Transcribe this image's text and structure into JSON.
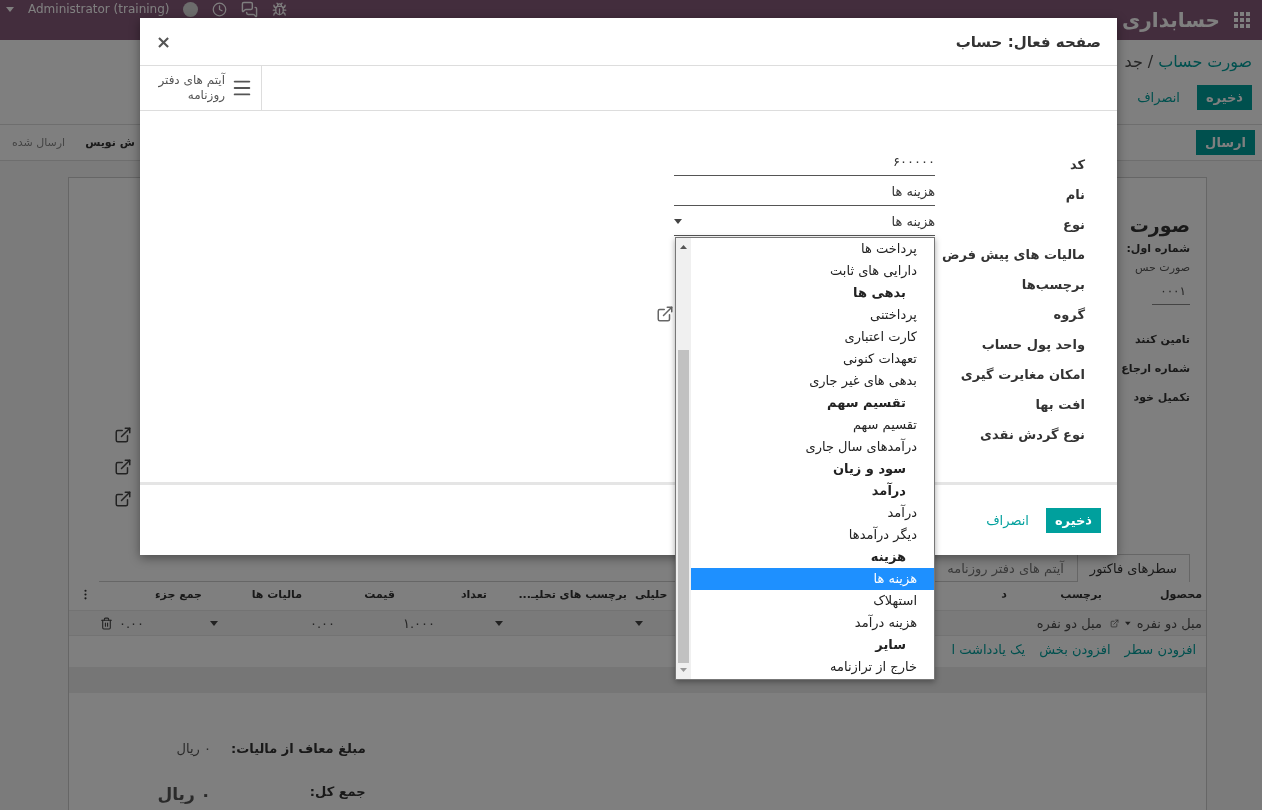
{
  "topbar": {
    "app_title": "حسابداری",
    "user": "Administrator (training)"
  },
  "breadcrumb": {
    "parent": "صورت حساب",
    "separator": "/",
    "current": "جد"
  },
  "form_buttons": [
    {
      "label": "ذخیره",
      "kind": "primary"
    },
    {
      "label": "انصراف",
      "kind": "link"
    }
  ],
  "status_bar": {
    "action": "ارسال",
    "stages": [
      {
        "label": "ش نویس",
        "selected": true
      },
      {
        "label": "ارسال شده",
        "selected": false
      }
    ]
  },
  "sheet": {
    "title": "صورت",
    "number_label": "شماره اول:",
    "journal": "صورت حس",
    "number": "۰۰۰۱",
    "field_labels": [
      "تامین کنند",
      "شماره ارجاع",
      "تکمیل خود"
    ],
    "tabs": [
      {
        "label": "سطرهای فاکتور",
        "selected": true
      },
      {
        "label": "آیتم های دفتر روزنامه",
        "selected": false
      }
    ],
    "table": {
      "columns": [
        "محصول",
        "برچسب",
        "د",
        "حلیلی",
        "برچسب های تحلیـ...",
        "تعداد",
        "قیمت",
        "مالیات ها",
        "جمع جزء"
      ],
      "rows": [
        {
          "product": "مبل دو نفره",
          "label": "مبل دو نفره",
          "quantity": "۱.۰۰۰",
          "price": "۰.۰۰",
          "subtotal": "۰.۰۰"
        }
      ],
      "add_links": [
        "افزودن سطر",
        "افزودن بخش",
        "یک یادداشت ا"
      ]
    },
    "totals": [
      {
        "label": "مبلغ معاف از مالیات:",
        "value": "۰ ریال",
        "kind": "normal"
      },
      {
        "label": "جمع کل:",
        "value": "۰ ریال",
        "kind": "grand"
      }
    ]
  },
  "modal": {
    "title": "صفحه فعال: حساب",
    "close": "×",
    "smart_button": "آیتم های دفتر روزنامه",
    "fields": [
      {
        "label": "کد",
        "kind": "input",
        "value": "۶۰۰۰۰۰"
      },
      {
        "label": "نام",
        "kind": "input",
        "value": "هزینه ها"
      },
      {
        "label": "نوع",
        "kind": "select",
        "value": "هزینه ها"
      },
      {
        "label": "مالیات های پیش فرض"
      },
      {
        "label": "برچسب‌ها"
      },
      {
        "label": "گروه",
        "kind": "link"
      },
      {
        "label": "واحد پول حساب"
      },
      {
        "label": "امکان مغایرت گیری"
      },
      {
        "label": "افت بها"
      },
      {
        "label": "نوع گردش نقدی"
      }
    ],
    "footer_buttons": [
      {
        "label": "ذخیره",
        "kind": "primary"
      },
      {
        "label": "انصراف",
        "kind": "link"
      }
    ],
    "type_options": [
      {
        "label": "پرداخت ها",
        "kind": "option",
        "selected": false
      },
      {
        "label": "دارایی های ثابت",
        "kind": "option",
        "selected": false
      },
      {
        "label": "بدهی ها",
        "kind": "group",
        "selected": false
      },
      {
        "label": "پرداختنی",
        "kind": "option",
        "selected": false
      },
      {
        "label": "کارت اعتباری",
        "kind": "option",
        "selected": false
      },
      {
        "label": "تعهدات کنونی",
        "kind": "option",
        "selected": false
      },
      {
        "label": "بدهی های غیر جاری",
        "kind": "option",
        "selected": false
      },
      {
        "label": "تقسیم سهم",
        "kind": "group",
        "selected": false
      },
      {
        "label": "تقسیم سهم",
        "kind": "option",
        "selected": false
      },
      {
        "label": "درآمدهای سال جاری",
        "kind": "option",
        "selected": false
      },
      {
        "label": "سود و زیان",
        "kind": "group",
        "selected": false
      },
      {
        "label": "درآمد",
        "kind": "group",
        "selected": false
      },
      {
        "label": "درآمد",
        "kind": "option",
        "selected": false
      },
      {
        "label": "دیگر درآمدها",
        "kind": "option",
        "selected": false
      },
      {
        "label": "هزینه",
        "kind": "group",
        "selected": false
      },
      {
        "label": "هزینه ها",
        "kind": "option",
        "selected": true
      },
      {
        "label": "استهلاک",
        "kind": "option",
        "selected": false
      },
      {
        "label": "هزینه درآمد",
        "kind": "option",
        "selected": false
      },
      {
        "label": "سایر",
        "kind": "group",
        "selected": false
      },
      {
        "label": "خارج از ترازنامه",
        "kind": "option",
        "selected": false
      }
    ]
  }
}
